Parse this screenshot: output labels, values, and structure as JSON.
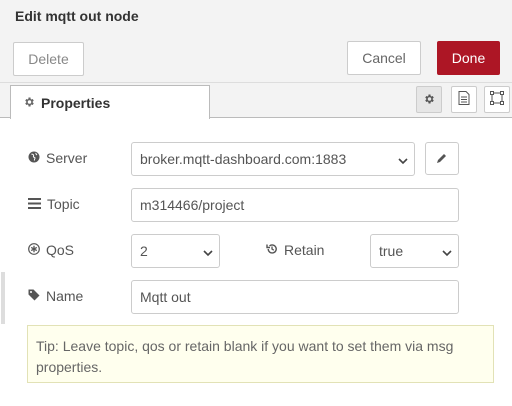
{
  "dialog": {
    "title": "Edit mqtt out node"
  },
  "toolbar": {
    "delete_label": "Delete",
    "cancel_label": "Cancel",
    "done_label": "Done"
  },
  "tabs": {
    "properties_label": "Properties"
  },
  "form": {
    "server": {
      "label": "Server",
      "value": "broker.mqtt-dashboard.com:1883"
    },
    "topic": {
      "label": "Topic",
      "value": "m314466/project"
    },
    "qos": {
      "label": "QoS",
      "value": "2"
    },
    "retain": {
      "label": "Retain",
      "value": "true"
    },
    "name": {
      "label": "Name",
      "value": "Mqtt out"
    }
  },
  "tip": {
    "text": "Tip: Leave topic, qos or retain blank if you want to set them via msg properties."
  },
  "icons": {
    "properties": "gear-icon",
    "description": "document-icon",
    "appearance": "frame-icon",
    "server": "globe-icon",
    "topic": "list-icon",
    "qos": "asterisk-circle-icon",
    "retain": "history-icon",
    "name": "tag-icon",
    "edit": "pencil-icon"
  },
  "colors": {
    "done_bg": "#ad1625",
    "tip_bg": "#ffffee"
  }
}
